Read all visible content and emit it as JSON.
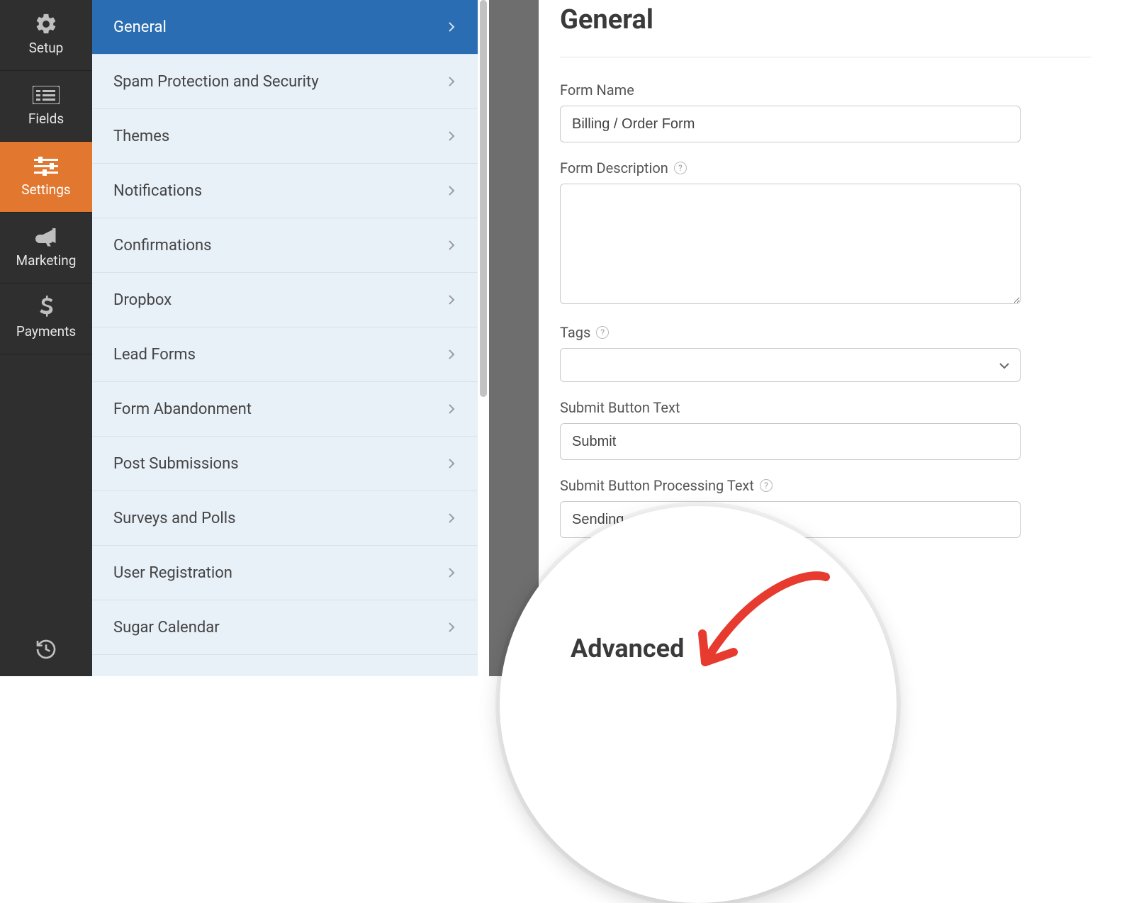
{
  "icon_sidebar": {
    "items": [
      {
        "key": "setup",
        "label": "Setup",
        "icon": "gear-icon"
      },
      {
        "key": "fields",
        "label": "Fields",
        "icon": "list-icon"
      },
      {
        "key": "settings",
        "label": "Settings",
        "icon": "sliders-icon",
        "active": true
      },
      {
        "key": "marketing",
        "label": "Marketing",
        "icon": "bullhorn-icon"
      },
      {
        "key": "payments",
        "label": "Payments",
        "icon": "dollar-icon"
      }
    ]
  },
  "submenu": {
    "items": [
      {
        "label": "General",
        "active": true
      },
      {
        "label": "Spam Protection and Security"
      },
      {
        "label": "Themes"
      },
      {
        "label": "Notifications"
      },
      {
        "label": "Confirmations"
      },
      {
        "label": "Dropbox"
      },
      {
        "label": "Lead Forms"
      },
      {
        "label": "Form Abandonment"
      },
      {
        "label": "Post Submissions"
      },
      {
        "label": "Surveys and Polls"
      },
      {
        "label": "User Registration"
      },
      {
        "label": "Sugar Calendar"
      }
    ]
  },
  "main": {
    "title": "General",
    "form_name": {
      "label": "Form Name",
      "value": "Billing / Order Form"
    },
    "form_description": {
      "label": "Form Description",
      "value": ""
    },
    "tags": {
      "label": "Tags",
      "selected": ""
    },
    "submit_text": {
      "label": "Submit Button Text",
      "value": "Submit"
    },
    "submit_processing": {
      "label": "Submit Button Processing Text",
      "value": "Sending..."
    },
    "advanced_title": "Advanced"
  },
  "colors": {
    "sidebar_bg": "#2f2f2f",
    "active_orange": "#e27730",
    "submenu_bg": "#e8f0f8",
    "submenu_active": "#2a6db2",
    "annotation_red": "#e63b2e"
  }
}
